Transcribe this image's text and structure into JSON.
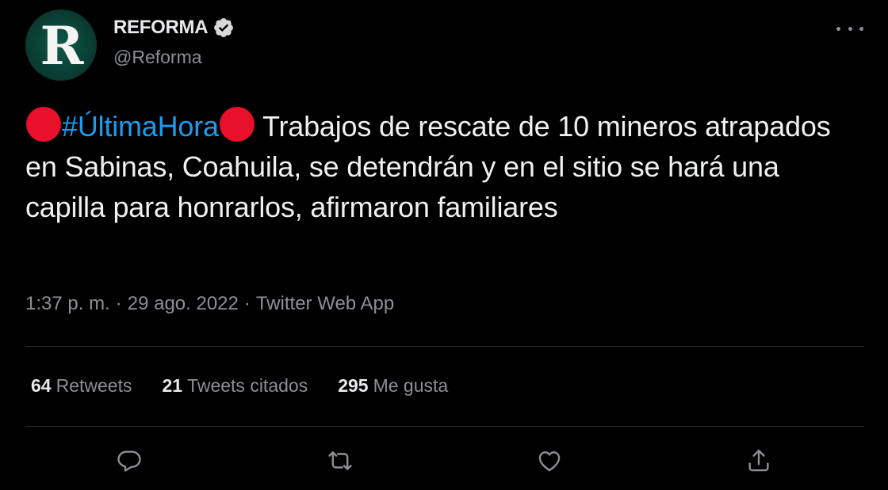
{
  "account": {
    "display_name": "REFORMA",
    "handle": "@Reforma",
    "avatar_letter": "R",
    "verified": true
  },
  "tweet": {
    "hashtag": "#ÚltimaHora",
    "body": " Trabajos de rescate de 10 mineros atrapados en Sabinas, Coahuila, se detendrán y en el sitio se hará una capilla para honrarlos, afirmaron familiares",
    "time": "1:37 p. m.",
    "separator": "·",
    "date": "29 ago. 2022",
    "client": "Twitter Web App"
  },
  "stats": {
    "retweets_count": "64",
    "retweets_label": "Retweets",
    "quotes_count": "21",
    "quotes_label": "Tweets citados",
    "likes_count": "295",
    "likes_label": "Me gusta"
  },
  "icons": {
    "more": "more-horizontal-icon",
    "verified": "verified-badge-icon",
    "reply": "reply-icon",
    "retweet": "retweet-icon",
    "like": "like-icon",
    "share": "share-icon",
    "emoji": "red-circle-emoji"
  },
  "colors": {
    "background": "#000000",
    "text": "#e7e9ea",
    "secondary": "#8b9095",
    "link": "#1d9bf0",
    "divider": "#2f3336",
    "red_circle": "#e8102a"
  }
}
